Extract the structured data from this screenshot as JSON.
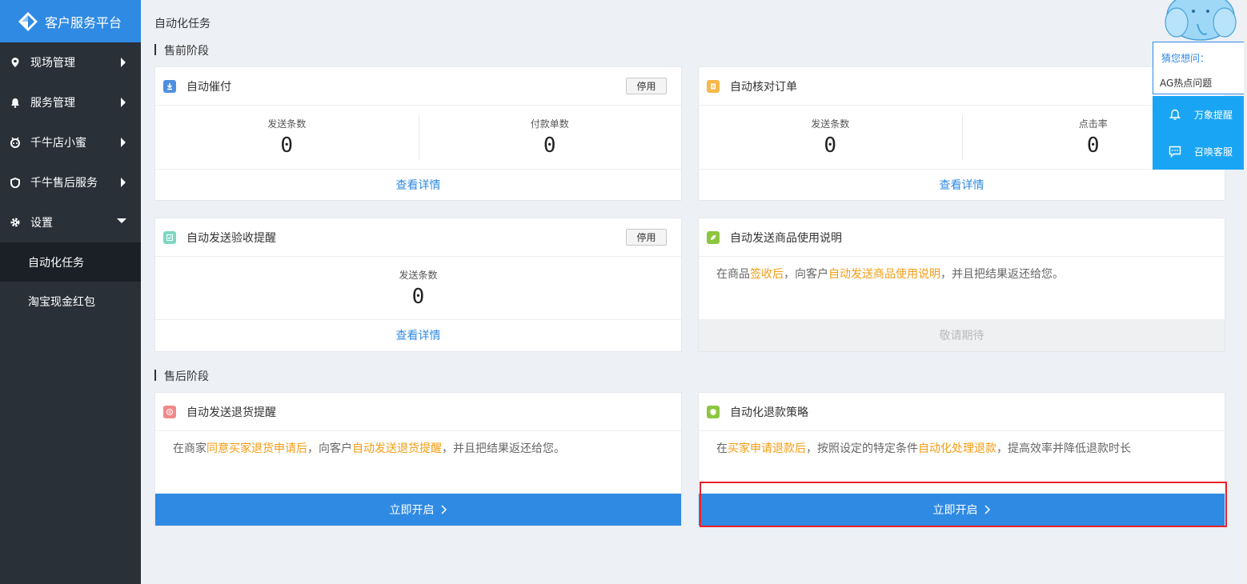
{
  "brand": {
    "title": "客户服务平台"
  },
  "sidebar": {
    "items": [
      {
        "label": "现场管理",
        "icon": "location-pin-icon"
      },
      {
        "label": "服务管理",
        "icon": "bell-icon"
      },
      {
        "label": "千牛店小蜜",
        "icon": "robot-icon"
      },
      {
        "label": "千牛售后服务",
        "icon": "shield-icon"
      },
      {
        "label": "设置",
        "icon": "gear-icon"
      }
    ],
    "sub_items": [
      {
        "label": "自动化任务",
        "active": true
      },
      {
        "label": "淘宝现金红包",
        "active": false
      }
    ]
  },
  "page": {
    "title": "自动化任务"
  },
  "presale": {
    "section_title": "售前阶段",
    "urge_pay": {
      "title": "自动催付",
      "disable_label": "停用",
      "stat1_label": "发送条数",
      "stat1_value": "0",
      "stat2_label": "付款单数",
      "stat2_value": "0",
      "detail_label": "查看详情"
    },
    "check_order": {
      "title": "自动核对订单",
      "stat1_label": "发送条数",
      "stat1_value": "0",
      "stat2_label": "点击率",
      "stat2_value": "0",
      "detail_label": "查看详情"
    },
    "receipt_reminder": {
      "title": "自动发送验收提醒",
      "disable_label": "停用",
      "stat1_label": "发送条数",
      "stat1_value": "0",
      "detail_label": "查看详情"
    },
    "usage_guide": {
      "title": "自动发送商品使用说明",
      "desc_1": "在商品",
      "desc_hl1": "签收后",
      "desc_2": "，向客户",
      "desc_hl2": "自动发送商品使用说明",
      "desc_3": "，并且把结果返还给您。",
      "coming_label": "敬请期待"
    }
  },
  "aftersale": {
    "section_title": "售后阶段",
    "return_reminder": {
      "title": "自动发送退货提醒",
      "desc_1": "在商家",
      "desc_hl1": "同意买家退货申请后",
      "desc_2": "，向客户",
      "desc_hl2": "自动发送退货提醒",
      "desc_3": "，并且把结果返还给您。",
      "start_label": "立即开启"
    },
    "refund_strategy": {
      "title": "自动化退款策略",
      "desc_1": "在",
      "desc_hl1": "买家申请退款后",
      "desc_2": "，按照设定的特定条件",
      "desc_hl2": "自动化处理退款",
      "desc_3": "，提高效率并降低退款时长",
      "start_label": "立即开启"
    }
  },
  "float_widget": {
    "guess_title": "猜您想问：",
    "question": "AG热点问题",
    "btn_remind": "万象提醒",
    "btn_service": "召唤客服"
  },
  "colors": {
    "accent": "#2f8ae3",
    "sidebar_bg": "#293038",
    "highlight_text": "#f39c12",
    "float_button": "#1aa5f4",
    "focus_border": "#e8242a"
  }
}
